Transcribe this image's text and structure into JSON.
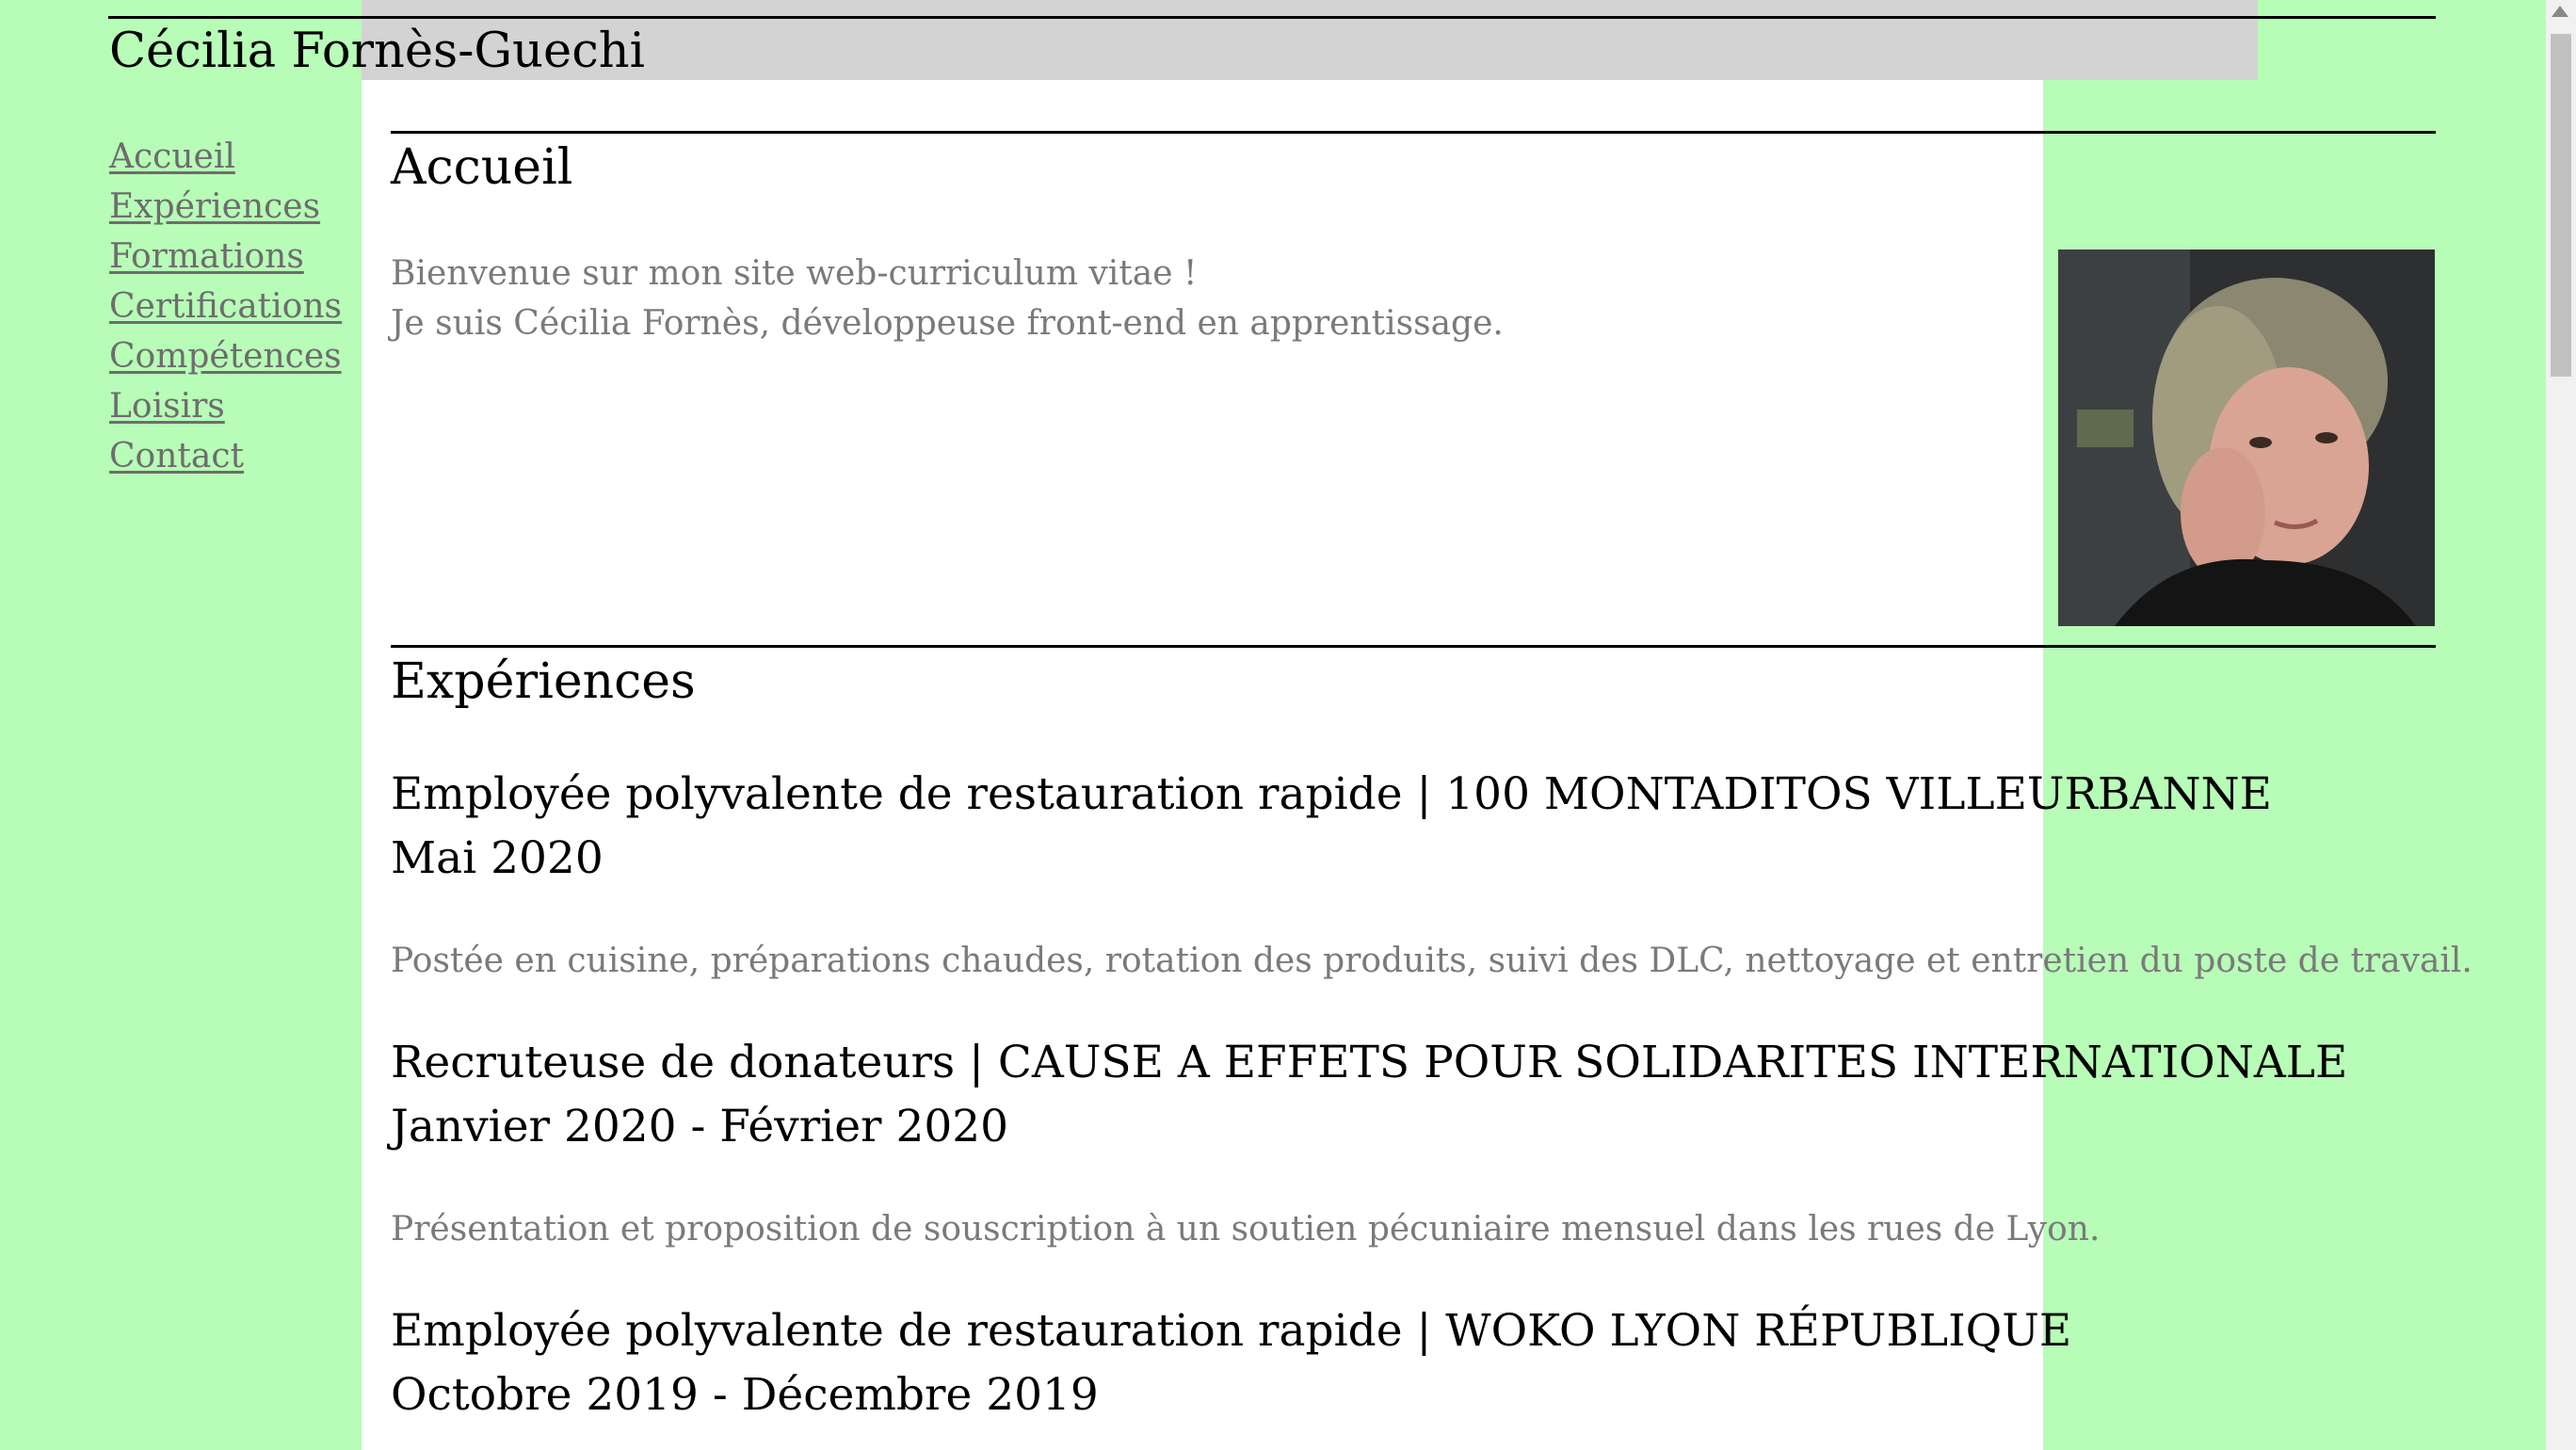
{
  "header": {
    "site_title": "Cécilia Fornès-Guechi"
  },
  "nav": {
    "items": [
      {
        "label": "Accueil"
      },
      {
        "label": "Expériences"
      },
      {
        "label": "Formations"
      },
      {
        "label": "Certifications"
      },
      {
        "label": "Compétences"
      },
      {
        "label": "Loisirs"
      },
      {
        "label": "Contact"
      }
    ]
  },
  "accueil": {
    "heading": "Accueil",
    "line1": "Bienvenue sur mon site web-curriculum vitae !",
    "line2": "Je suis Cécilia Fornès, développeuse front-end en apprentissage."
  },
  "experiences": {
    "heading": "Expériences",
    "jobs": [
      {
        "title": "Employée polyvalente de restauration rapide | 100 MONTADITOS VILLEURBANNE",
        "dates": "Mai 2020",
        "description": "Postée en cuisine, préparations chaudes, rotation des produits, suivi des DLC, nettoyage et entretien du poste de travail."
      },
      {
        "title": "Recruteuse de donateurs | CAUSE A EFFETS POUR SOLIDARITES INTERNATIONALE",
        "dates": "Janvier 2020 - Février 2020",
        "description": "Présentation et proposition de souscription à un soutien pécuniaire mensuel dans les rues de Lyon."
      },
      {
        "title": "Employée polyvalente de restauration rapide | WOKO LYON RÉPUBLIQUE",
        "dates": "Octobre 2019 - Décembre 2019"
      }
    ]
  }
}
